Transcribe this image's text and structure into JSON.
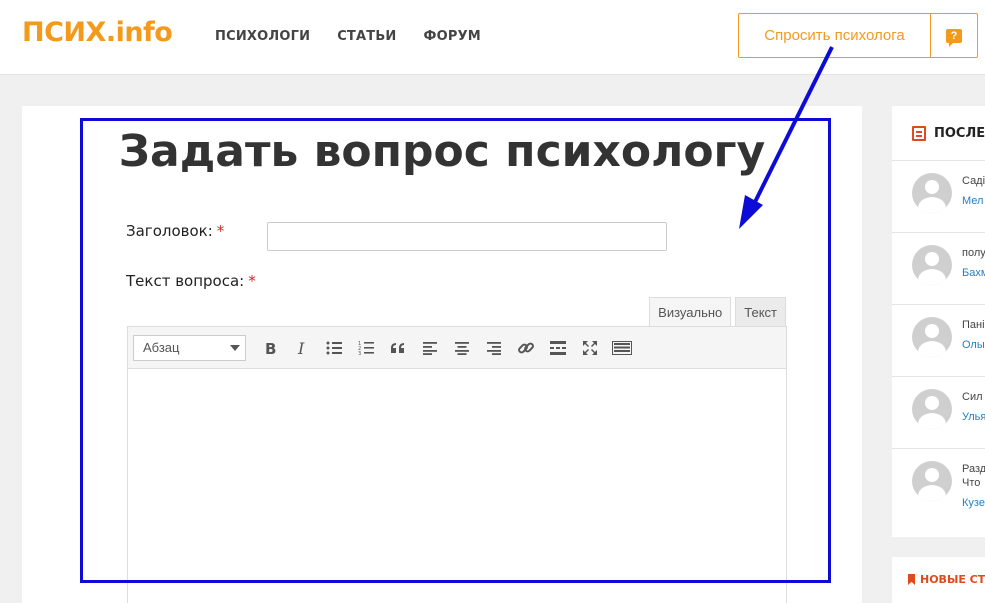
{
  "header": {
    "logo": "ПСИХ.info",
    "nav": [
      "ПСИХОЛОГИ",
      "СТАТЬИ",
      "ФОРУМ"
    ],
    "ask_button": "Спросить психолога",
    "ask_icon_glyph": "?"
  },
  "main": {
    "title": "Задать вопрос психологу",
    "title_label": "Заголовок:",
    "text_label": "Текст вопроса:",
    "required_mark": "*",
    "title_value": "",
    "editor": {
      "tab_visual": "Визуально",
      "tab_text": "Текст",
      "format_select": "Абзац",
      "toolbar_icons": [
        "bold-icon",
        "italic-icon",
        "bulleted-list-icon",
        "numbered-list-icon",
        "blockquote-icon",
        "align-left-icon",
        "align-center-icon",
        "align-right-icon",
        "link-icon",
        "read-more-icon",
        "fullscreen-icon",
        "keyboard-icon"
      ],
      "content": ""
    }
  },
  "sidebar": {
    "header": "ПОСЛЕ",
    "items": [
      {
        "text": "Саді",
        "text2": "",
        "link": "Мел"
      },
      {
        "text": "полу",
        "text2": "",
        "link": "Бахм"
      },
      {
        "text": "Пані",
        "text2": "",
        "link": "Олы"
      },
      {
        "text": "Сил",
        "text2": "",
        "link": "Улья"
      },
      {
        "text": "Разд",
        "text2": "Что",
        "link": "Кузе"
      }
    ],
    "header2": "НОВЫЕ СТА"
  },
  "colors": {
    "accent": "#f39a1d",
    "link": "#1f7fc8",
    "highlight": "#0c0cd6",
    "icon_red": "#e04a1c"
  }
}
